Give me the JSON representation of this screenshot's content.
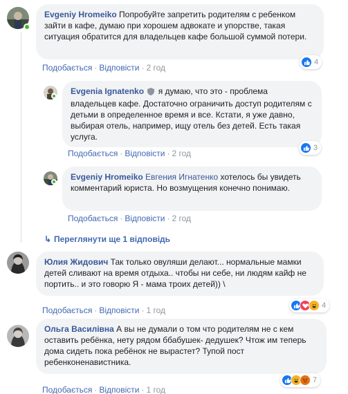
{
  "comments": [
    {
      "author": "Evgeniy Hromeiko",
      "text": "Попробуйте запретить родителям с ребенком зайти в кафе, думаю при хорошем адвокате и упорстве, такая ситуация обратится для владельцев кафе большой суммой потери.",
      "like_label": "Подобається",
      "reply_label": "Відповісти",
      "time": "2 год",
      "reaction_count": "4"
    },
    {
      "author": "Evgenia Ignatenko",
      "text": "я думаю, что это - проблема владельцев кафе. Достаточно ограничить доступ родителям с детьми в определенное время и все. Кстати, я уже давно, выбирая отель, например, ищу отель без детей. Есть такая услуга.",
      "like_label": "Подобається",
      "reply_label": "Відповісти",
      "time": "2 год",
      "reaction_count": "3"
    },
    {
      "author": "Evgeniy Hromeiko",
      "mention": "Евгения Игнатенко",
      "text": "хотелось бы увидеть комментарий юриста. Но возмущения конечно понимаю.",
      "like_label": "Подобається",
      "reply_label": "Відповісти",
      "time": "2 год"
    },
    {
      "author": "Юлия Жидович",
      "text": "Так только овуляши делают... нормальные мамки детей сливают на время отдыха.. чтобы ни себе, ни людям кайф не портить.. и это говорю Я - мама троих детей))",
      "text_tail": "\\",
      "like_label": "Подобається",
      "reply_label": "Відповісти",
      "time": "1 год",
      "reaction_count": "4"
    },
    {
      "author": "Ольга Василівна",
      "text": "А вы не думали о том что родителям не с кем оставить ребёнка, нету рядом ббабушек- дедушек? Чтож им теперь дома сидеть пока ребёнок не вырастет? Тупой пост ребенконенавистника.",
      "like_label": "Подобається",
      "reply_label": "Відповісти",
      "time": "1 год",
      "reaction_count": "7"
    }
  ],
  "more_replies": "Переглянути ще 1 відповідь",
  "separator": "·",
  "colors": {
    "link": "#385898",
    "action": "#4267b2",
    "bubble": "#f2f3f5",
    "online": "#42b72a"
  }
}
